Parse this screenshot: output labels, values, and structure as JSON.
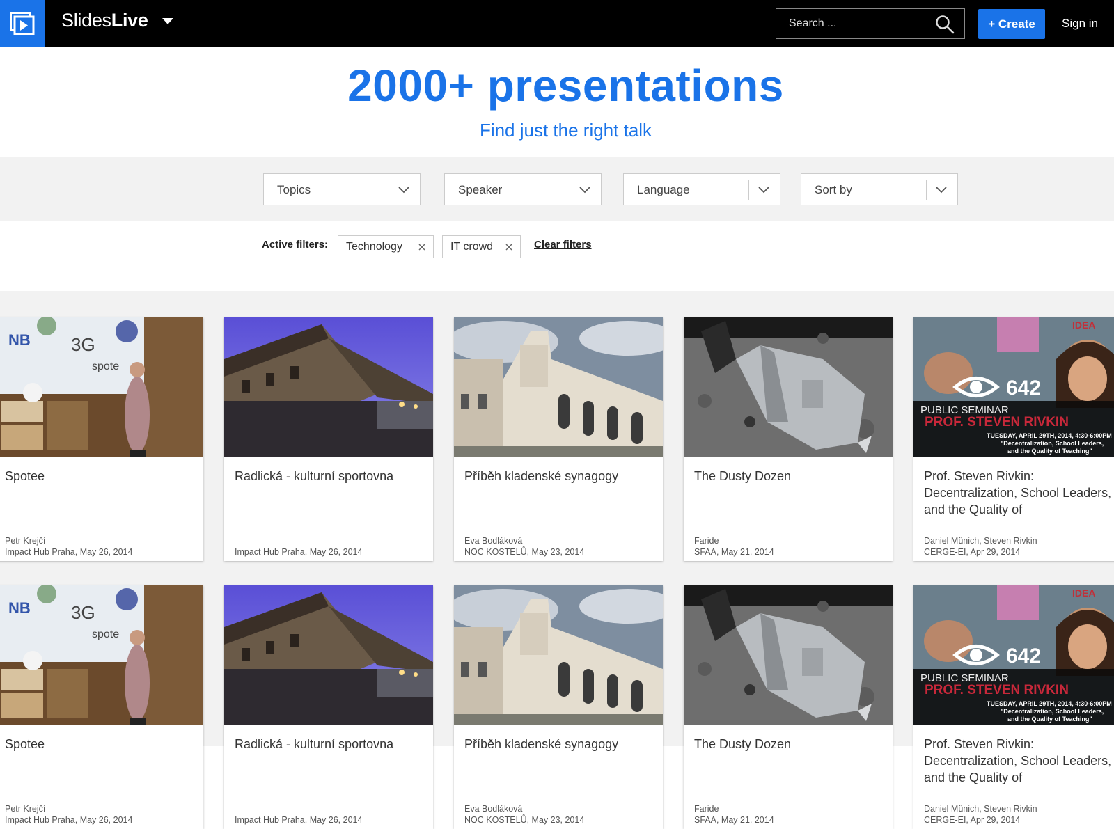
{
  "header": {
    "brand_light": "Slides",
    "brand_bold": "Live",
    "search_placeholder": "Search ...",
    "create_label": "+ Create",
    "signin_label": "Sign in"
  },
  "hero": {
    "title": "2000+ presentations",
    "subtitle": "Find just the right talk"
  },
  "filters": {
    "dropdowns": [
      "Topics",
      "Speaker",
      "Language",
      "Sort by"
    ],
    "active_label": "Active filters:",
    "active": [
      "Technology",
      "IT crowd"
    ],
    "clear_label": "Clear filters"
  },
  "cards": [
    {
      "title": "Spotee",
      "speaker": "Petr Krejčí",
      "venue": "Impact Hub Praha, May 26, 2014"
    },
    {
      "title": "Radlická - kulturní sportovna",
      "speaker": "",
      "venue": "Impact Hub Praha, May 26, 2014"
    },
    {
      "title": "Příběh kladenské synagogy",
      "speaker": "Eva Bodláková",
      "venue": "NOC KOSTELŮ, May 23, 2014"
    },
    {
      "title": "The Dusty Dozen",
      "speaker": "Faride",
      "venue": "SFAA, May 21, 2014"
    },
    {
      "title": "Prof. Steven Rivkin: Decentralization, School Leaders, and the Quality of",
      "speaker": "Daniel Münich, Steven Rivkin",
      "venue": "CERGE-EI, Apr 29, 2014"
    }
  ],
  "thumb_text": {
    "spotee_banner": "spote",
    "idea_logo": "IDEA",
    "views": "642",
    "seminar_line1": "PUBLIC SEMINAR",
    "seminar_line2": "PROF. STEVEN RIVKIN",
    "seminar_line3": "TUESDAY, APRIL 29TH, 2014, 4:30-6:00PM",
    "seminar_line4": "\"Decentralization, School Leaders,",
    "seminar_line5": "and the Quality of Teaching\""
  },
  "colors": {
    "accent": "#1a73e8",
    "topbar": "#000000",
    "band": "#f2f2f2"
  },
  "icons": [
    "play-logo-icon",
    "caret-down-icon",
    "search-icon",
    "chevron-down-icon",
    "close-icon",
    "eye-icon"
  ]
}
